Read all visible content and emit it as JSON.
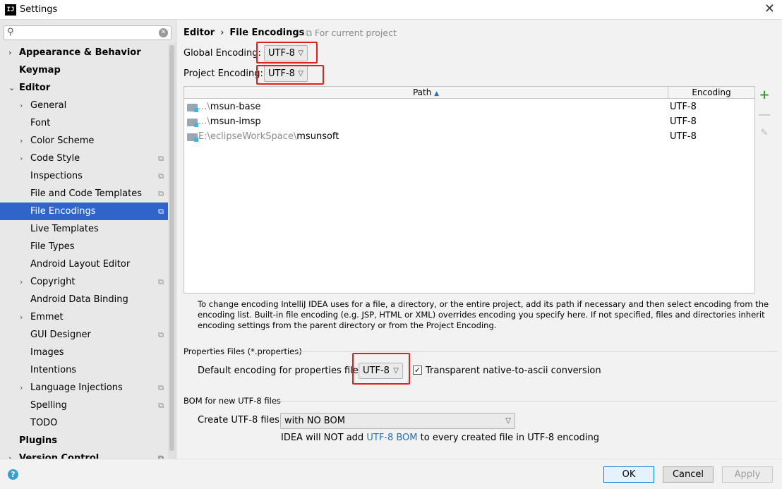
{
  "window": {
    "title": "Settings",
    "app_icon": "IJ",
    "close_glyph": "✕"
  },
  "search": {
    "value": "",
    "placeholder": ""
  },
  "sidebar": {
    "items": [
      {
        "label": "Appearance & Behavior",
        "level": "top",
        "arrow": "›",
        "proj": ""
      },
      {
        "label": "Keymap",
        "level": "top",
        "arrow": "",
        "proj": ""
      },
      {
        "label": "Editor",
        "level": "top",
        "arrow": "⌄",
        "proj": ""
      },
      {
        "label": "General",
        "level": "child",
        "arrow": "›",
        "proj": ""
      },
      {
        "label": "Font",
        "level": "child",
        "arrow": "",
        "proj": ""
      },
      {
        "label": "Color Scheme",
        "level": "child",
        "arrow": "›",
        "proj": ""
      },
      {
        "label": "Code Style",
        "level": "child",
        "arrow": "›",
        "proj": "⧉"
      },
      {
        "label": "Inspections",
        "level": "child",
        "arrow": "",
        "proj": "⧉"
      },
      {
        "label": "File and Code Templates",
        "level": "child",
        "arrow": "",
        "proj": "⧉"
      },
      {
        "label": "File Encodings",
        "level": "child",
        "arrow": "",
        "proj": "⧉",
        "selected": true
      },
      {
        "label": "Live Templates",
        "level": "child",
        "arrow": "",
        "proj": ""
      },
      {
        "label": "File Types",
        "level": "child",
        "arrow": "",
        "proj": ""
      },
      {
        "label": "Android Layout Editor",
        "level": "child",
        "arrow": "",
        "proj": ""
      },
      {
        "label": "Copyright",
        "level": "child",
        "arrow": "›",
        "proj": "⧉"
      },
      {
        "label": "Android Data Binding",
        "level": "child",
        "arrow": "",
        "proj": ""
      },
      {
        "label": "Emmet",
        "level": "child",
        "arrow": "›",
        "proj": ""
      },
      {
        "label": "GUI Designer",
        "level": "child",
        "arrow": "",
        "proj": "⧉"
      },
      {
        "label": "Images",
        "level": "child",
        "arrow": "",
        "proj": ""
      },
      {
        "label": "Intentions",
        "level": "child",
        "arrow": "",
        "proj": ""
      },
      {
        "label": "Language Injections",
        "level": "child",
        "arrow": "›",
        "proj": "⧉"
      },
      {
        "label": "Spelling",
        "level": "child",
        "arrow": "",
        "proj": "⧉"
      },
      {
        "label": "TODO",
        "level": "child",
        "arrow": "",
        "proj": ""
      },
      {
        "label": "Plugins",
        "level": "top",
        "arrow": "",
        "proj": ""
      },
      {
        "label": "Version Control",
        "level": "top",
        "arrow": "›",
        "proj": "⧉"
      }
    ]
  },
  "main": {
    "breadcrumb": {
      "parent": "Editor",
      "separator": "›",
      "current": "File Encodings"
    },
    "for_project": "⧉ For current project",
    "global_encoding": {
      "label": "Global Encoding:",
      "value": "UTF-8"
    },
    "project_encoding": {
      "label": "Project Encoding:",
      "value": "UTF-8"
    },
    "table": {
      "headers": {
        "path": "Path",
        "sort_arrow": "▲",
        "encoding": "Encoding"
      },
      "rows": [
        {
          "path_prefix": "...\\",
          "path_main": "msun-base",
          "encoding": "UTF-8"
        },
        {
          "path_prefix": "...\\",
          "path_main": "msun-imsp",
          "encoding": "UTF-8"
        },
        {
          "path_prefix": "E:\\eclipseWorkSpace\\",
          "path_main": "msunsoft",
          "encoding": "UTF-8"
        }
      ]
    },
    "tools": {
      "add": "+",
      "remove": "—",
      "edit": "✎"
    },
    "help_text": "To change encoding IntelliJ IDEA uses for a file, a directory, or the entire project, add its path if necessary and then select encoding from the encoding list. Built-in file encoding (e.g. JSP, HTML or XML) overrides encoding you specify here. If not specified, files and directories inherit encoding settings from the parent directory or from the Project Encoding.",
    "properties": {
      "section_title": "Properties Files (*.properties)",
      "default_label": "Default encoding for properties files:",
      "default_value": "UTF-8",
      "transparent_label": "Transparent native-to-ascii conversion",
      "transparent_checked": "✓"
    },
    "bom": {
      "section_title": "BOM for new UTF-8 files",
      "create_label": "Create UTF-8 files:",
      "create_value": "with NO BOM",
      "note_before": "IDEA will NOT add ",
      "note_link": "UTF-8 BOM",
      "note_after": " to every created file in UTF-8 encoding"
    }
  },
  "footer": {
    "help": "?",
    "ok": "OK",
    "cancel": "Cancel",
    "apply": "Apply"
  },
  "colors": {
    "selection": "#2f65ca",
    "highlight": "#e02020",
    "link": "#2470b3"
  }
}
